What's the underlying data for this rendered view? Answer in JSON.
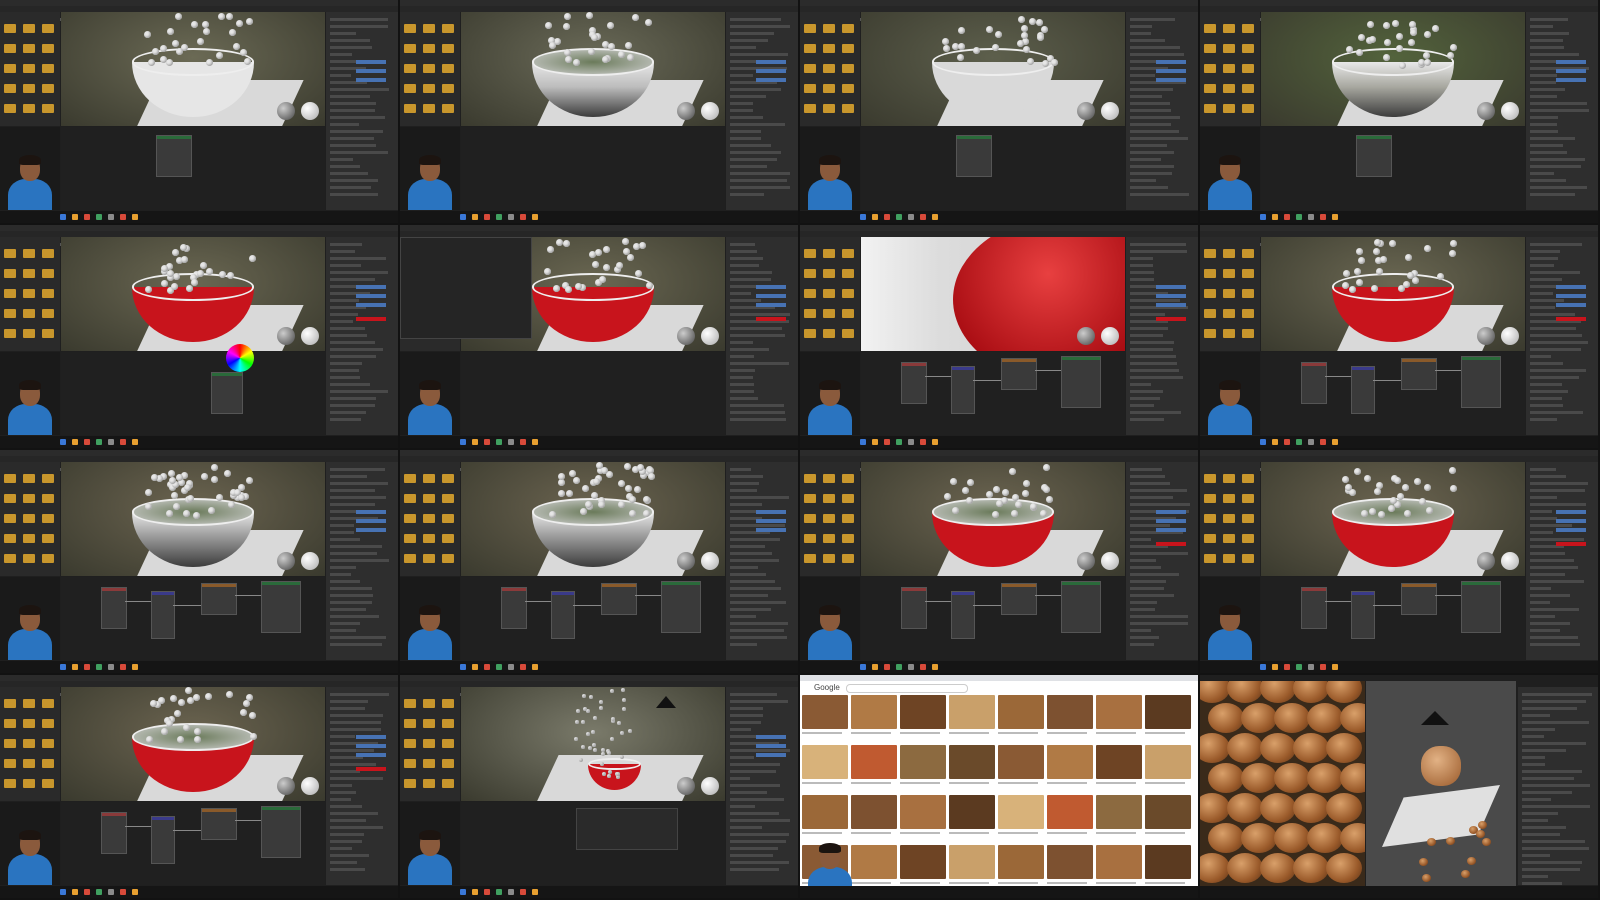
{
  "layout": {
    "columns": 4,
    "rows": 4
  },
  "theme": {
    "accent": "#4772b3",
    "bowl_red": "#c8141c",
    "kibble_brown": "#9a5a2a",
    "folder": "#c8962c"
  },
  "tiles": [
    {
      "id": 1,
      "scene": "white-bowl",
      "bowl": "#e6e6e6",
      "bg": "#6b6a55",
      "nodes": "sparse"
    },
    {
      "id": 2,
      "scene": "chrome-bowl",
      "bowl": "#bdbdbd",
      "bg": "#6a6a58",
      "nodes": "none"
    },
    {
      "id": 3,
      "scene": "white-bowl",
      "bowl": "#d9d9d9",
      "bg": "#5d5f4c",
      "nodes": "sparse"
    },
    {
      "id": 4,
      "scene": "glass-bowl",
      "bowl": "#a8a8a0",
      "bg": "#53633c",
      "nodes": "sparse"
    },
    {
      "id": 5,
      "scene": "red-bowl",
      "bowl": "#c8141c",
      "bg": "#6a6752",
      "nodes": "color-picker"
    },
    {
      "id": 6,
      "scene": "red-bowl",
      "bowl": "#c8141c",
      "bg": "#6a6752",
      "nodes": "menu"
    },
    {
      "id": 7,
      "scene": "red-closeup",
      "bowl": "#c8141c",
      "bg": "#eeeeee",
      "nodes": "graph"
    },
    {
      "id": 8,
      "scene": "red-bowl",
      "bowl": "#c8141c",
      "bg": "#6a6752",
      "nodes": "graph"
    },
    {
      "id": 9,
      "scene": "chrome-bowl-full",
      "bowl": "#9a9a9a",
      "bg": "#6b6450",
      "nodes": "graph"
    },
    {
      "id": 10,
      "scene": "chrome-bowl-full",
      "bowl": "#9a9a9a",
      "bg": "#6b6450",
      "nodes": "graph"
    },
    {
      "id": 11,
      "scene": "red-chrome-bowl",
      "bowl": "#c8141c",
      "bg": "#6b6450",
      "nodes": "graph"
    },
    {
      "id": 12,
      "scene": "red-chrome-bowl",
      "bowl": "#c8141c",
      "bg": "#6b6450",
      "nodes": "graph"
    },
    {
      "id": 13,
      "scene": "red-chrome-bowl",
      "bowl": "#c8141c",
      "bg": "#6b6450",
      "nodes": "graph"
    },
    {
      "id": 14,
      "scene": "small-bowl",
      "bowl": "#c8141c",
      "bg": "#7a7a6a",
      "nodes": "panel"
    },
    {
      "id": 15,
      "scene": "google-images",
      "search_logo": "Google"
    },
    {
      "id": 16,
      "scene": "kibble-closeup",
      "bg": "#3a2a1a"
    }
  ]
}
